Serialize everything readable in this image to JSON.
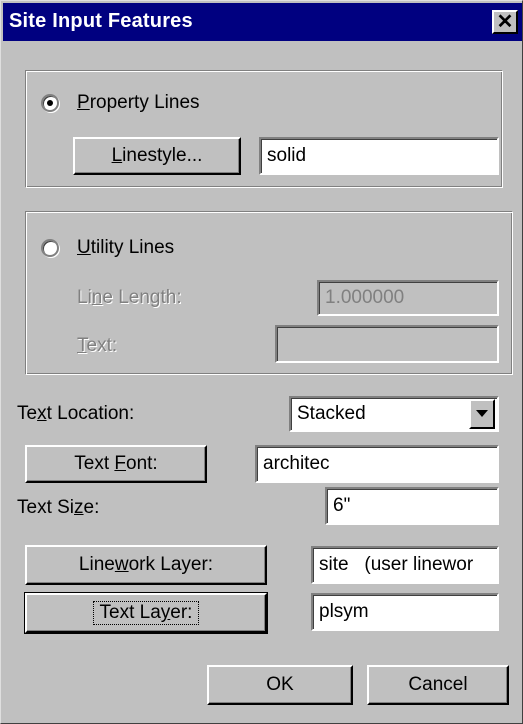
{
  "window": {
    "title": "Site Input Features",
    "close_glyph": "✕"
  },
  "property_lines": {
    "label_prefix": "",
    "label_mnemonic": "P",
    "label_rest": "roperty Lines",
    "selected": true,
    "linestyle_button": {
      "pre": "",
      "mn": "L",
      "post": "inestyle..."
    },
    "linestyle_value": "solid"
  },
  "utility_lines": {
    "label_prefix": "",
    "label_mnemonic": "U",
    "label_rest": "tility Lines",
    "selected": false,
    "line_length_label": {
      "pre": "Li",
      "mn": "n",
      "post": "e Length:"
    },
    "line_length_value": "1.000000",
    "text_label": {
      "pre": "",
      "mn": "T",
      "post": "ext:"
    },
    "text_value": ""
  },
  "text_location": {
    "label": {
      "pre": "Te",
      "mn": "x",
      "post": "t Location:"
    },
    "value": "Stacked",
    "arrow_icon": "triangle-down"
  },
  "text_font": {
    "button": {
      "pre": "Text ",
      "mn": "F",
      "post": "ont:"
    },
    "value": "architec"
  },
  "text_size": {
    "label": {
      "pre": "Text Si",
      "mn": "z",
      "post": "e:"
    },
    "value": "6\""
  },
  "linework_layer": {
    "button": {
      "pre": "Line",
      "mn": "w",
      "post": "ork Layer:"
    },
    "value": "site   (user linewor"
  },
  "text_layer": {
    "button": {
      "pre": "Text La",
      "mn": "y",
      "post": "er:"
    },
    "value": "plsym"
  },
  "footer": {
    "ok_label": "OK",
    "cancel_label": "Cancel"
  }
}
